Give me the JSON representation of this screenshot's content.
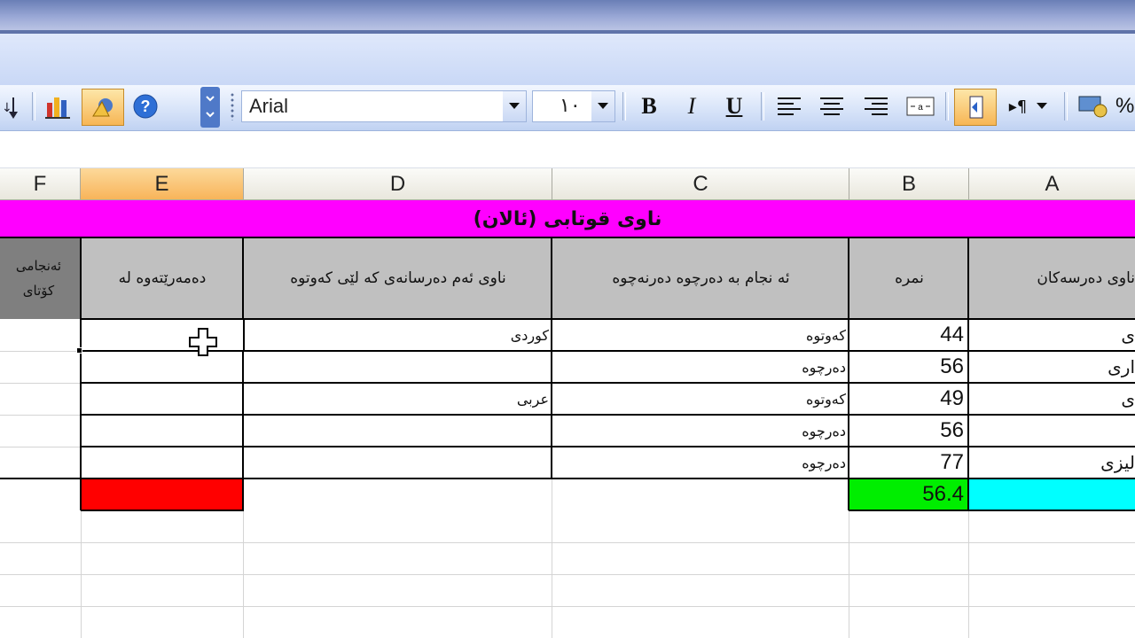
{
  "toolbar": {
    "font_name": "Arial",
    "font_size": "١٠",
    "bold_label": "B",
    "italic_label": "I",
    "underline_label": "U",
    "percent_label": "%"
  },
  "columns": [
    {
      "letter": "F"
    },
    {
      "letter": "E"
    },
    {
      "letter": "D"
    },
    {
      "letter": "C"
    },
    {
      "letter": "B"
    },
    {
      "letter": "A"
    }
  ],
  "sheet": {
    "title": "ناوی قوتابی (ئالان)",
    "headers": {
      "A": "ناوی دەرسەکان",
      "B": "نمرە",
      "C": "ئە نجام بە دەرچوە دەرنەچوە",
      "D": "ناوی ئەم دەرسانەی کە لێی کەوتوە",
      "E": "دەمەرێتەوە لە",
      "F": "ئەنجامی کۆتای"
    },
    "rows": [
      {
        "A": "ی",
        "B": "44",
        "C": "کەوتوە",
        "D": "کوردی",
        "E": ""
      },
      {
        "A": "اری",
        "B": "56",
        "C": "دەرچوە",
        "D": "",
        "E": ""
      },
      {
        "A": "ی",
        "B": "49",
        "C": "کەوتوە",
        "D": "عربی",
        "E": ""
      },
      {
        "A": "",
        "B": "56",
        "C": "دەرچوە",
        "D": "",
        "E": ""
      },
      {
        "A": "لیزی",
        "B": "77",
        "C": "دەرچوە",
        "D": "",
        "E": ""
      }
    ],
    "summary": {
      "A": "",
      "B": "56.4"
    }
  },
  "colors": {
    "title_fill": "#ff00ff",
    "average_fill": "#00ee00",
    "a_summary_fill": "#00ffff",
    "e_summary_fill": "#ff0000",
    "header_fill": "#c0c0c0",
    "f_header_fill": "#7f7f7f",
    "selected_col_header": "#f8b45a"
  }
}
